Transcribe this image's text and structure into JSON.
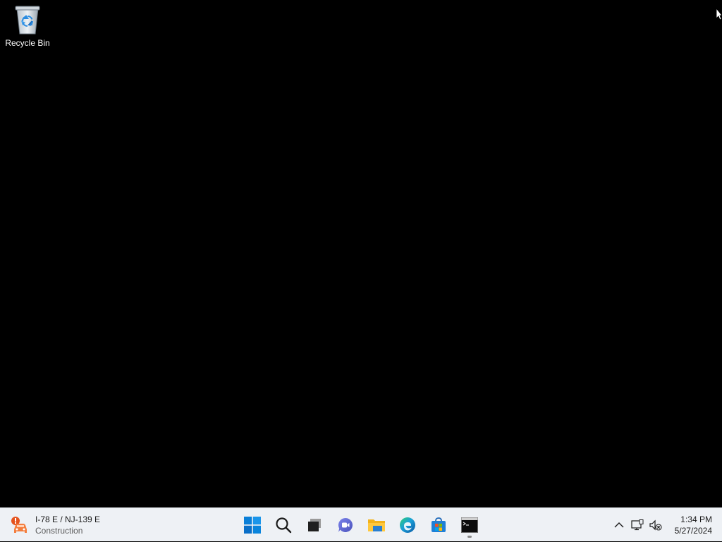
{
  "desktop": {
    "background_color": "#000000",
    "icons": [
      {
        "label": "Recycle Bin",
        "icon": "recycle-bin-icon"
      }
    ]
  },
  "taskbar": {
    "background_color": "#eef1f5",
    "widget": {
      "icon": "traffic-alert-icon",
      "title": "I-78 E / NJ-139 E",
      "subtitle": "Construction"
    },
    "apps": [
      {
        "name": "Start",
        "icon": "windows-start-icon",
        "running": false
      },
      {
        "name": "Search",
        "icon": "search-icon",
        "running": false
      },
      {
        "name": "Task View",
        "icon": "task-view-icon",
        "running": false
      },
      {
        "name": "Chat",
        "icon": "chat-icon",
        "running": false
      },
      {
        "name": "File Explorer",
        "icon": "file-explorer-icon",
        "running": false
      },
      {
        "name": "Microsoft Edge",
        "icon": "edge-icon",
        "running": false
      },
      {
        "name": "Microsoft Store",
        "icon": "store-icon",
        "running": false
      },
      {
        "name": "Command Prompt",
        "icon": "terminal-icon",
        "running": true
      }
    ],
    "tray": {
      "icons": [
        "chevron-up-icon",
        "network-icon",
        "volume-muted-icon"
      ]
    },
    "clock": {
      "time": "1:34 PM",
      "date": "5/27/2024"
    }
  }
}
